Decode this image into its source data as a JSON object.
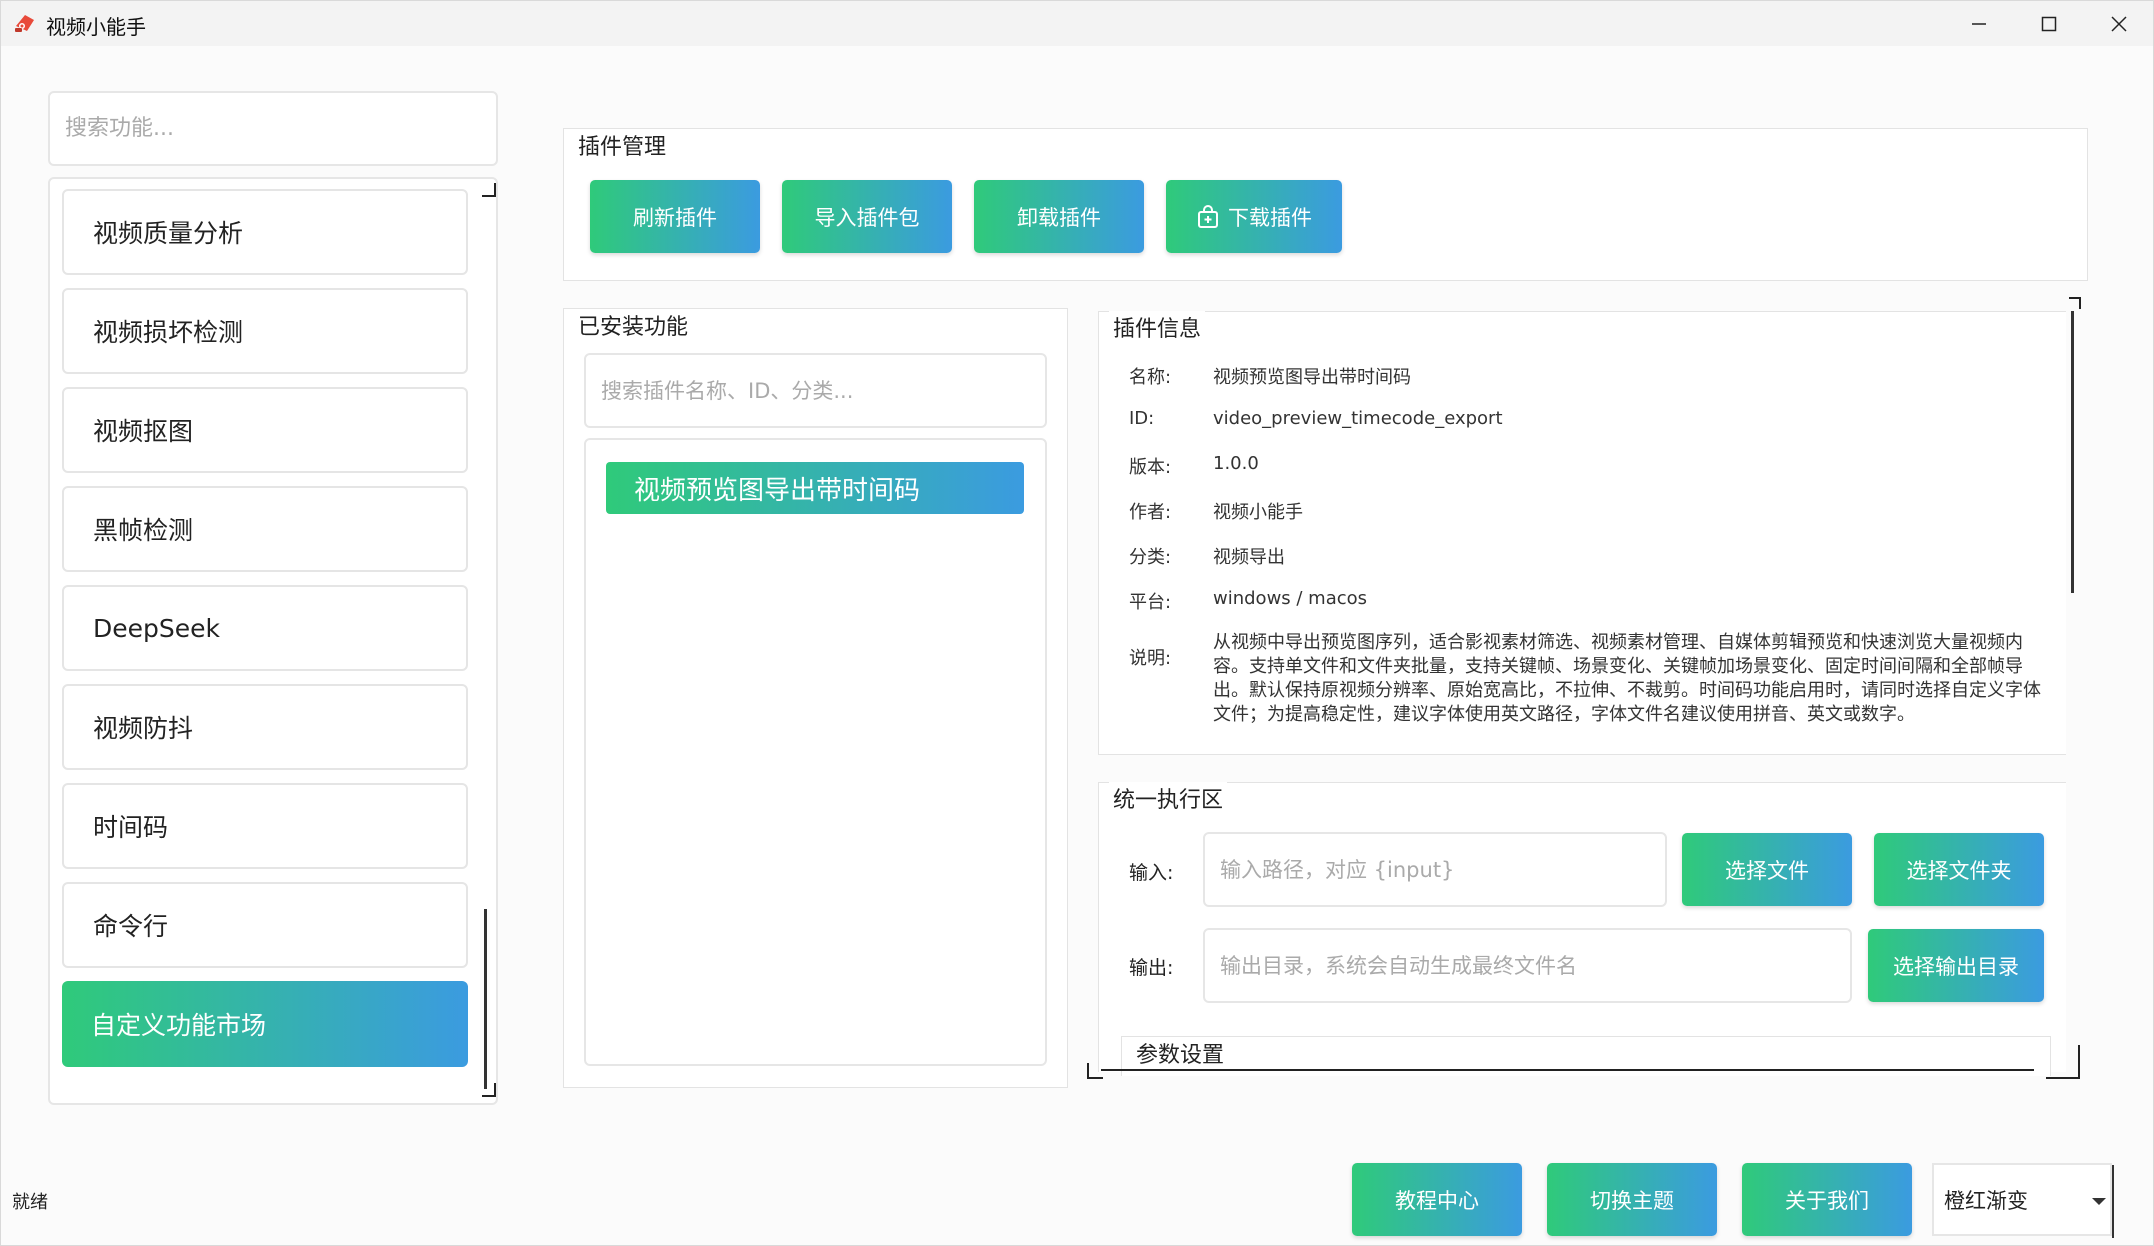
{
  "window": {
    "title": "视频小能手",
    "controls": {
      "minimize": "—",
      "maximize": "☐",
      "close": "✕"
    }
  },
  "sidebar": {
    "search_placeholder": "搜索功能...",
    "items": [
      {
        "label": "视频质量分析"
      },
      {
        "label": "视频损坏检测"
      },
      {
        "label": "视频抠图"
      },
      {
        "label": "黑帧检测"
      },
      {
        "label": "DeepSeek"
      },
      {
        "label": "视频防抖"
      },
      {
        "label": "时间码"
      },
      {
        "label": "命令行"
      },
      {
        "label": "自定义功能市场",
        "active": true
      }
    ]
  },
  "plugin_mgmt": {
    "title": "插件管理",
    "buttons": {
      "refresh": "刷新插件",
      "import": "导入插件包",
      "uninstall": "卸载插件",
      "download": "下载插件"
    }
  },
  "installed": {
    "title": "已安装功能",
    "search_placeholder": "搜索插件名称、ID、分类...",
    "items": [
      {
        "label": "视频预览图导出带时间码",
        "active": true
      }
    ]
  },
  "plugin_info": {
    "title": "插件信息",
    "labels": {
      "name": "名称:",
      "id": "ID:",
      "version": "版本:",
      "author": "作者:",
      "category": "分类:",
      "platform": "平台:",
      "description": "说明:"
    },
    "values": {
      "name": "视频预览图导出带时间码",
      "id": "video_preview_timecode_export",
      "version": "1.0.0",
      "author": "视频小能手",
      "category": "视频导出",
      "platform": "windows / macos",
      "description": "从视频中导出预览图序列，适合影视素材筛选、视频素材管理、自媒体剪辑预览和快速浏览大量视频内容。支持单文件和文件夹批量，支持关键帧、场景变化、关键帧加场景变化、固定时间间隔和全部帧导出。默认保持原视频分辨率、原始宽高比，不拉伸、不裁剪。时间码功能启用时，请同时选择自定义字体文件；为提高稳定性，建议字体使用英文路径，字体文件名建议使用拼音、英文或数字。"
    }
  },
  "exec": {
    "title": "统一执行区",
    "input_label": "输入:",
    "input_placeholder": "输入路径，对应 {input}",
    "select_file": "选择文件",
    "select_folder": "选择文件夹",
    "output_label": "输出:",
    "output_placeholder": "输出目录，系统会自动生成最终文件名",
    "select_output": "选择输出目录",
    "params_title": "参数设置"
  },
  "footer": {
    "status": "就绪",
    "tutorial": "教程中心",
    "switch_theme": "切换主题",
    "about": "关于我们",
    "theme_value": "橙红渐变"
  },
  "colors": {
    "gradient_start": "#2fca7a",
    "gradient_end": "#3b9be0"
  }
}
